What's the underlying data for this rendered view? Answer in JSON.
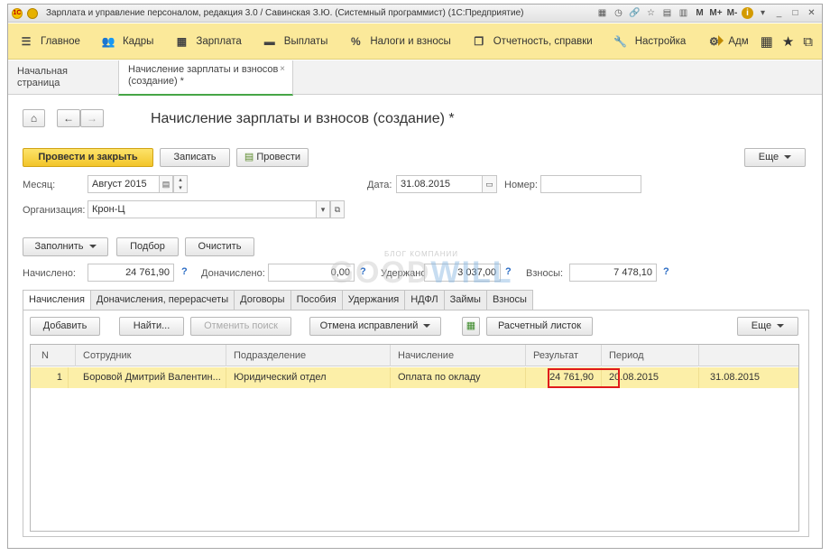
{
  "window": {
    "title": "Зарплата и управление персоналом, редакция 3.0 / Савинская З.Ю. (Системный программист)  (1С:Предприятие)",
    "logo_text": "1С",
    "title_icons": [
      "M",
      "M+",
      "M-",
      "i"
    ]
  },
  "sections": [
    {
      "icon": "menu-icon",
      "glyph": "☰",
      "label": "Главное"
    },
    {
      "icon": "people-icon",
      "glyph": "👥",
      "label": "Кадры"
    },
    {
      "icon": "calculator-icon",
      "glyph": "▦",
      "label": "Зарплата"
    },
    {
      "icon": "wallet-icon",
      "glyph": "▬",
      "label": "Выплаты"
    },
    {
      "icon": "percent-icon",
      "glyph": "%",
      "label": "Налоги и взносы"
    },
    {
      "icon": "reports-icon",
      "glyph": "❐",
      "label": "Отчетность, справки"
    },
    {
      "icon": "wrench-icon",
      "glyph": "🔧",
      "label": "Настройка"
    },
    {
      "icon": "gear-icon",
      "glyph": "⚙",
      "label": "Адм"
    }
  ],
  "open_tabs": {
    "home": "Начальная страница",
    "active": "Начисление зарплаты и взносов (создание) *"
  },
  "document": {
    "title": "Начисление зарплаты и взносов (создание) *"
  },
  "toolbar": {
    "post_and_close": "Провести и закрыть",
    "save": "Записать",
    "post": "Провести",
    "more": "Еще"
  },
  "form": {
    "month_label": "Месяц:",
    "month_value": "Август 2015",
    "date_label": "Дата:",
    "date_value": "31.08.2015",
    "number_label": "Номер:",
    "number_value": "",
    "org_label": "Организация:",
    "org_value": "Крон-Ц"
  },
  "actions": {
    "fill": "Заполнить",
    "select": "Подбор",
    "clear": "Очистить"
  },
  "totals": {
    "accrued_label": "Начислено:",
    "accrued_value": "24 761,90",
    "additional_label": "Доначислено:",
    "additional_value": "0,00",
    "withheld_label": "Удержано:",
    "withheld_value": "3 037,00",
    "contributions_label": "Взносы:",
    "contributions_value": "7 478,10",
    "help": "?"
  },
  "form_tabs": [
    "Начисления",
    "Доначисления, перерасчеты",
    "Договоры",
    "Пособия",
    "Удержания",
    "НДФЛ",
    "Займы",
    "Взносы"
  ],
  "grid_toolbar": {
    "add": "Добавить",
    "find": "Найти...",
    "cancel_search": "Отменить поиск",
    "cancel_corrections": "Отмена исправлений",
    "payslip": "Расчетный листок",
    "more": "Еще"
  },
  "grid": {
    "columns": [
      "N",
      "Сотрудник",
      "Подразделение",
      "Начисление",
      "Результат",
      "Период",
      ""
    ],
    "rows": [
      {
        "n": "1",
        "employee": "Боровой Дмитрий Валентин...",
        "department": "Юридический отдел",
        "accrual": "Оплата по окладу",
        "result": "24 761,90",
        "period_start": "20.08.2015",
        "period_end": "31.08.2015"
      }
    ]
  },
  "watermark": {
    "small": "БЛОГ КОМПАНИИ",
    "big_left": "GOOD",
    "big_right": "WILL"
  },
  "colors": {
    "sections_bg": "#fbe99a",
    "primary_button": "#f2c52a",
    "selected_row": "#fcefa8",
    "highlight_border": "#e01b1b",
    "active_tab_underline": "#46a546"
  }
}
